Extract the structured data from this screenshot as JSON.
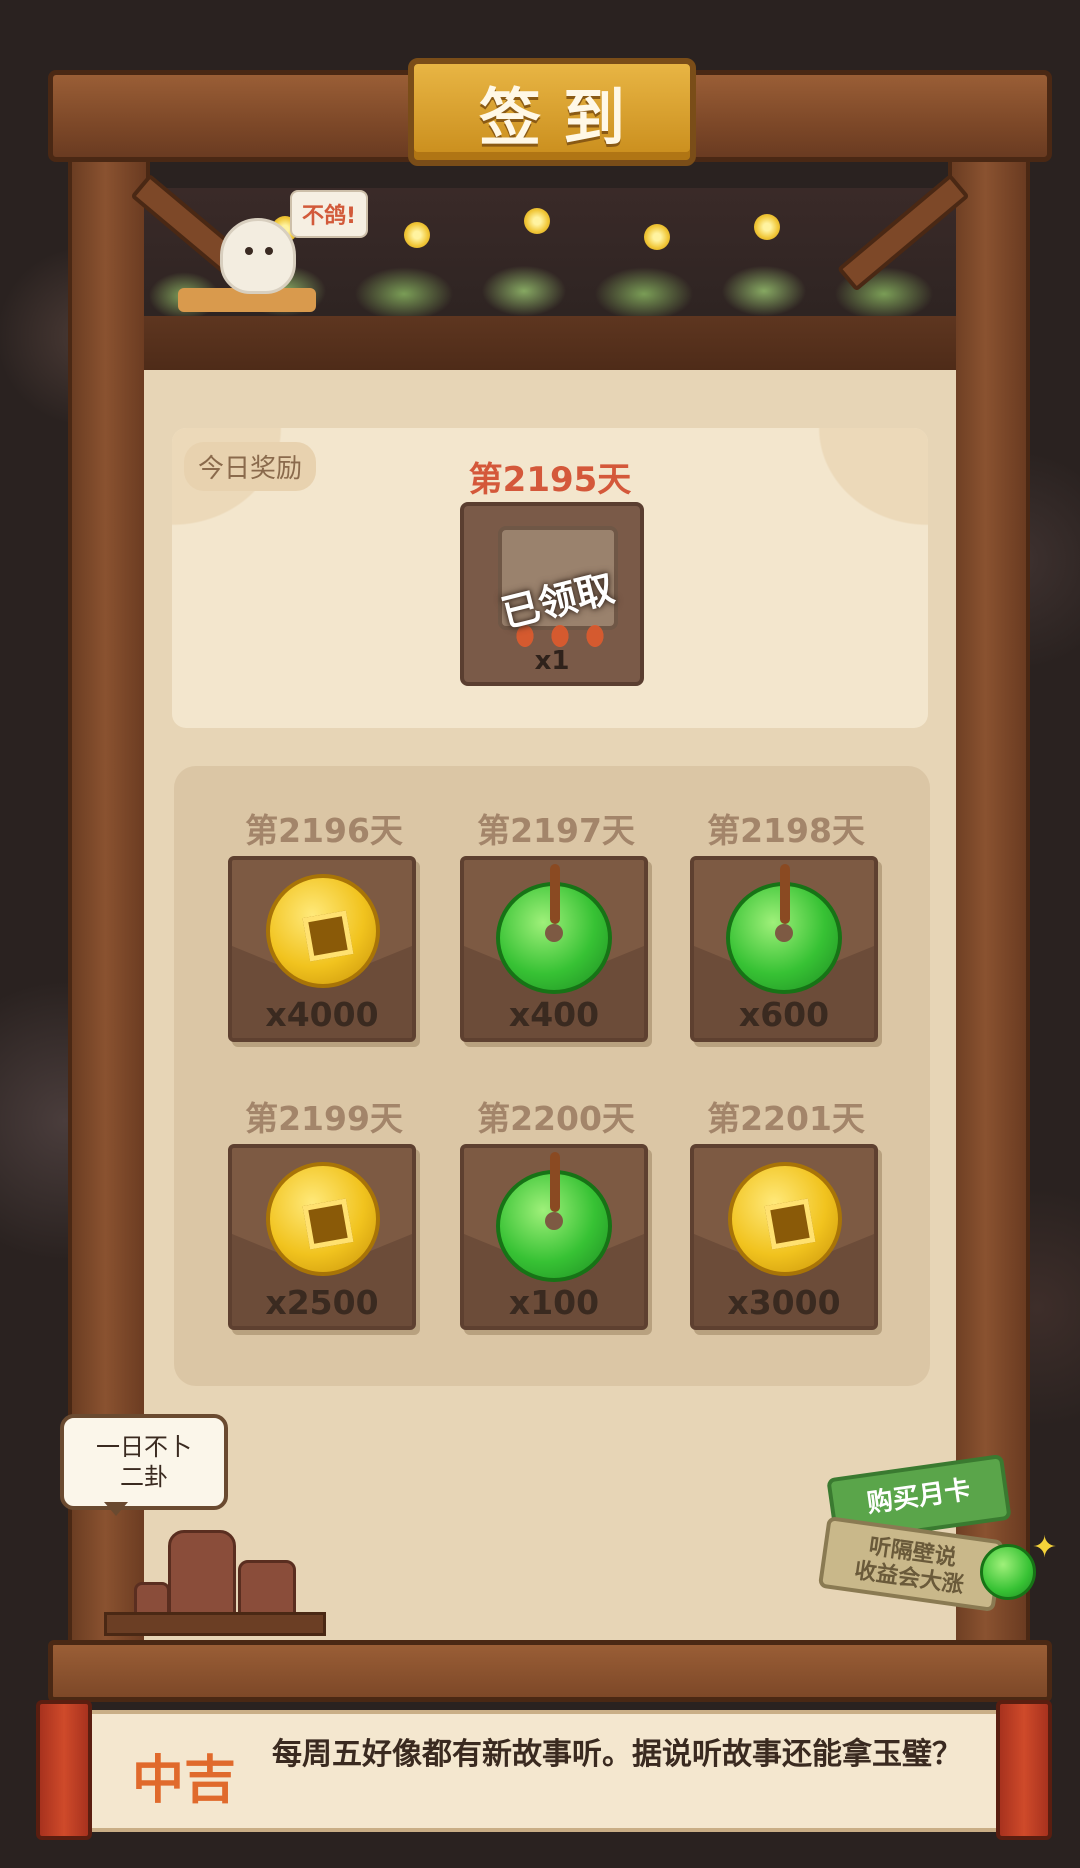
{
  "header": {
    "title": "签到"
  },
  "decor": {
    "bird_tag": "不鸽!"
  },
  "today": {
    "tag": "今日奖励",
    "day_label": "第2195天",
    "quantity": "x1",
    "status": "已领取",
    "item_icon": "scroll-icon"
  },
  "upcoming": [
    {
      "day_label": "第2196天",
      "quantity": "x4000",
      "icon": "coin-icon"
    },
    {
      "day_label": "第2197天",
      "quantity": "x400",
      "icon": "jade-icon"
    },
    {
      "day_label": "第2198天",
      "quantity": "x600",
      "icon": "jade-icon"
    },
    {
      "day_label": "第2199天",
      "quantity": "x2500",
      "icon": "coin-icon"
    },
    {
      "day_label": "第2200天",
      "quantity": "x100",
      "icon": "jade-icon"
    },
    {
      "day_label": "第2201天",
      "quantity": "x3000",
      "icon": "coin-icon"
    }
  ],
  "bubble": {
    "line1": "一日不卜",
    "line2": "二卦"
  },
  "month_card": {
    "label": "购买月卡",
    "line1": "听隔壁说",
    "line2": "收益会大涨"
  },
  "fortune": {
    "label": "中吉",
    "text": "每周五好像都有新故事听。据说听故事还能拿玉璧？"
  },
  "colors": {
    "title_gold": "#e8b544",
    "day_highlight": "#d4583a",
    "day_muted": "#a3856a",
    "fortune_orange": "#e06a2c",
    "wood": "#7d4828"
  }
}
